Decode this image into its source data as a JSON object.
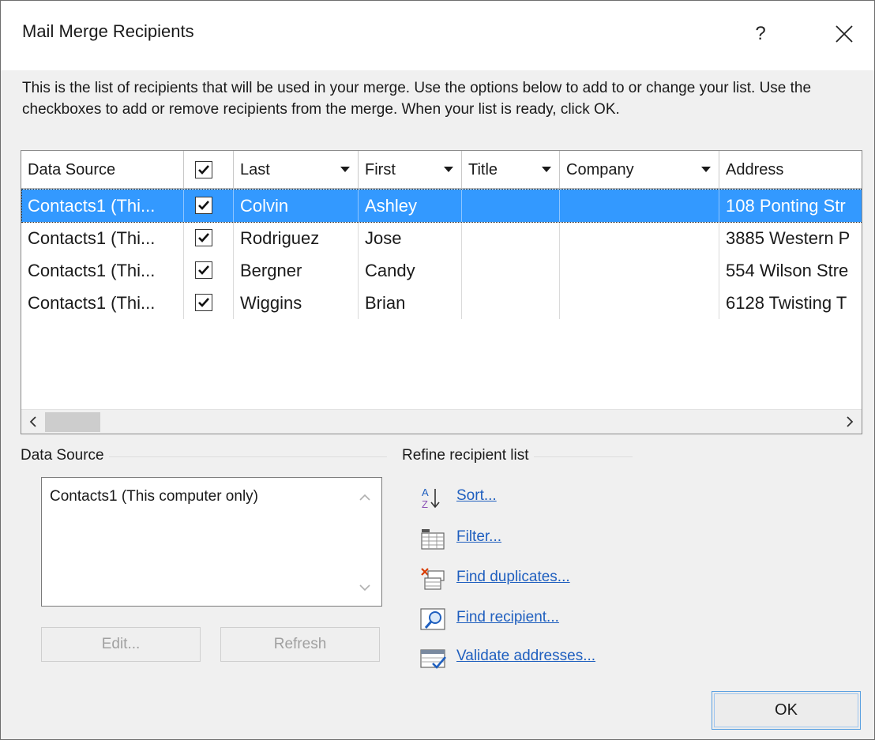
{
  "dialog": {
    "title": "Mail Merge Recipients",
    "help": "?",
    "intro": "This is the list of recipients that will be used in your merge.  Use the options below to add to or change your list.  Use the checkboxes to add or remove recipients from the merge.  When your list is ready, click OK."
  },
  "grid": {
    "columns": [
      "Data Source",
      "",
      "Last",
      "First",
      "Title",
      "Company",
      "Address"
    ],
    "rows": [
      {
        "source": "Contacts1 (Thi...",
        "checked": true,
        "last": "Colvin",
        "first": "Ashley",
        "title": "",
        "company": "",
        "address": "108 Ponting Str",
        "selected": true
      },
      {
        "source": "Contacts1 (Thi...",
        "checked": true,
        "last": "Rodriguez",
        "first": "Jose",
        "title": "",
        "company": "",
        "address": "3885 Western P",
        "selected": false
      },
      {
        "source": "Contacts1 (Thi...",
        "checked": true,
        "last": "Bergner",
        "first": "Candy",
        "title": "",
        "company": "",
        "address": "554 Wilson Stre",
        "selected": false
      },
      {
        "source": "Contacts1 (Thi...",
        "checked": true,
        "last": "Wiggins",
        "first": "Brian",
        "title": "",
        "company": "",
        "address": "6128 Twisting T",
        "selected": false
      }
    ],
    "scroll_left": "<",
    "scroll_right": ">"
  },
  "data_source": {
    "label": "Data Source",
    "items": [
      "Contacts1 (This computer only)"
    ],
    "edit_label": "Edit...",
    "refresh_label": "Refresh"
  },
  "refine": {
    "label": "Refine recipient list",
    "items": [
      {
        "label": "Sort...",
        "icon": "sort-az-icon"
      },
      {
        "label": "Filter...",
        "icon": "filter-icon"
      },
      {
        "label": "Find duplicates...",
        "icon": "find-duplicates-icon"
      },
      {
        "label": "Find recipient...",
        "icon": "find-recipient-icon"
      },
      {
        "label": "Validate addresses...",
        "icon": "validate-addresses-icon"
      }
    ]
  },
  "footer": {
    "ok_label": "OK"
  },
  "colors": {
    "selection": "#3399ff",
    "link": "#1f5fbf",
    "dialog_bg": "#f0f0f0"
  }
}
